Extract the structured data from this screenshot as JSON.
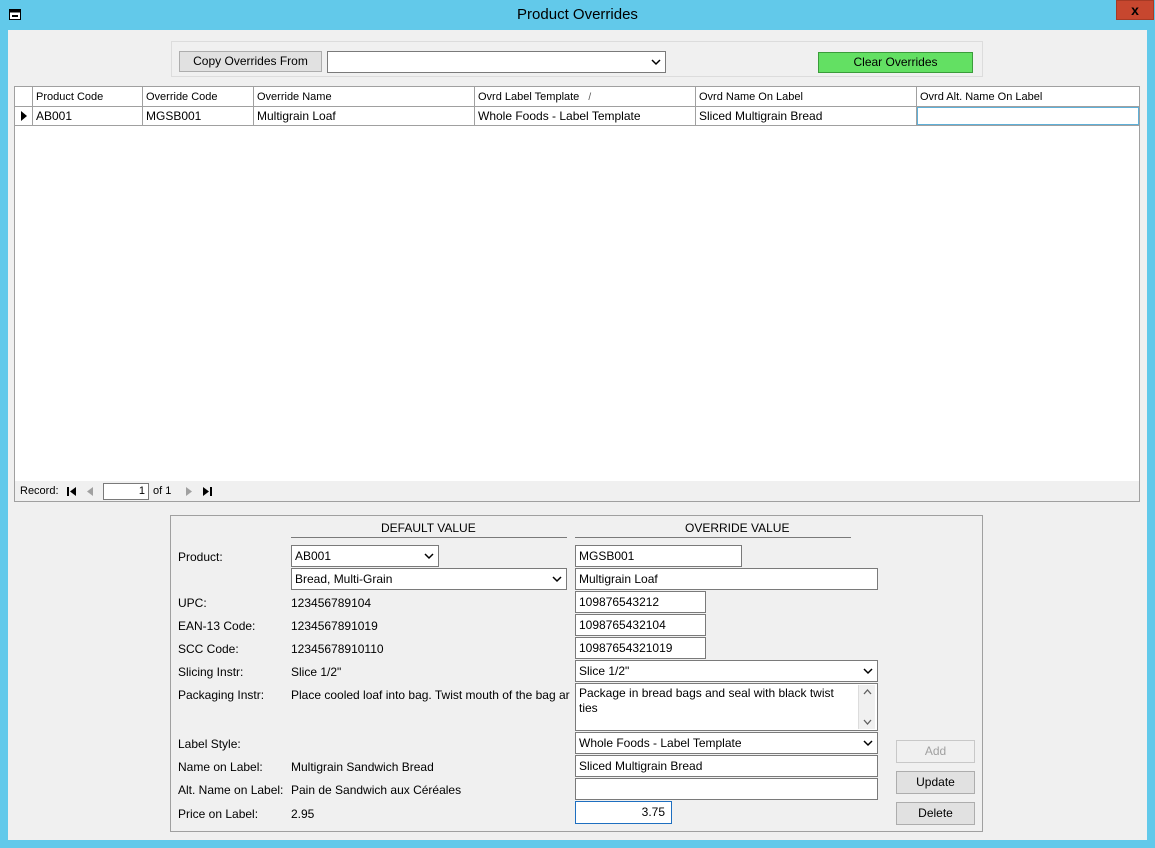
{
  "window": {
    "title": "Product Overrides",
    "close_glyph": "x"
  },
  "toolbar": {
    "copy_button": "Copy Overrides From",
    "copy_from_value": "",
    "clear_button": "Clear Overrides",
    "clear_color": "#63e063"
  },
  "grid": {
    "columns": [
      "Product Code",
      "Override Code",
      "Override Name",
      "Ovrd Label Template",
      "Ovrd Name On Label",
      "Ovrd Alt. Name On Label"
    ],
    "sort_glyph": "/",
    "rows": [
      [
        "AB001",
        "MGSB001",
        "Multigrain Loaf",
        "Whole Foods - Label Template",
        "Sliced Multigrain Bread",
        ""
      ]
    ]
  },
  "nav": {
    "label": "Record:",
    "current": "1",
    "of_text": "of 1"
  },
  "detail": {
    "default_header": "DEFAULT VALUE",
    "override_header": "OVERRIDE VALUE",
    "labels": {
      "product": "Product:",
      "upc": "UPC:",
      "ean": "EAN-13 Code:",
      "scc": "SCC Code:",
      "slicing": "Slicing Instr:",
      "packaging": "Packaging Instr:",
      "label_style": "Label Style:",
      "name_on_label": "Name on Label:",
      "alt_name": "Alt. Name on Label:",
      "price": "Price on Label:"
    },
    "defaults": {
      "product_code": "AB001",
      "product_name": "Bread, Multi-Grain",
      "upc": "123456789104",
      "ean": "1234567891019",
      "scc": "12345678910110",
      "slicing": "Slice 1/2\"",
      "packaging": "Place cooled loaf into bag. Twist mouth of the bag ar",
      "name_on_label": "Multigrain Sandwich Bread",
      "alt_name": "Pain de Sandwich aux Céréales",
      "price": "2.95"
    },
    "overrides": {
      "code": "MGSB001",
      "name": "Multigrain Loaf",
      "upc": "109876543212",
      "ean": "1098765432104",
      "scc": "10987654321019",
      "slicing": "Slice 1/2\"",
      "packaging": "Package in bread bags and seal with black twist ties",
      "label_style": "Whole Foods - Label Template",
      "name_on_label": "Sliced Multigrain Bread",
      "alt_name": "",
      "price": "3.75"
    },
    "buttons": {
      "add": "Add",
      "update": "Update",
      "delete": "Delete"
    }
  }
}
